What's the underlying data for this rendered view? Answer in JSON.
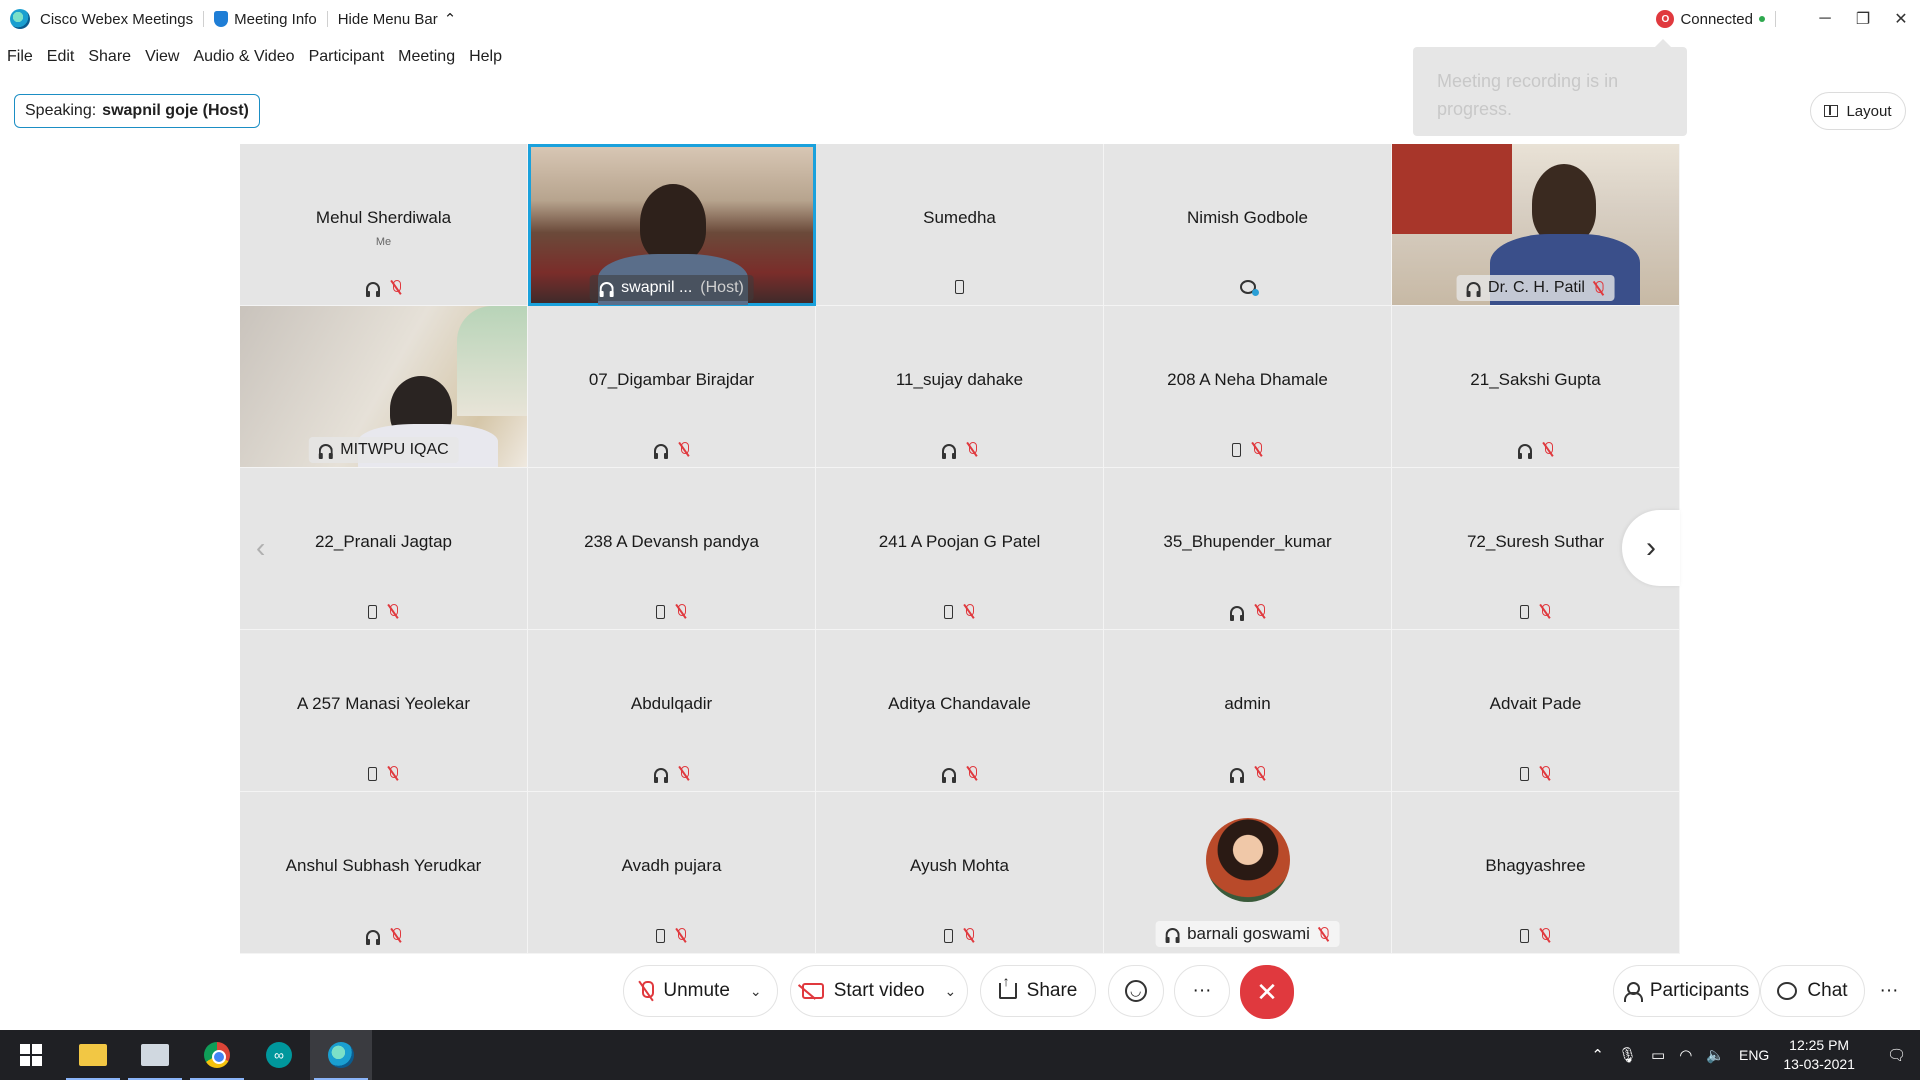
{
  "titlebar": {
    "app_name": "Cisco Webex Meetings",
    "meeting_info": "Meeting Info",
    "hide_menu": "Hide Menu Bar",
    "recording_badge": "O",
    "connection_status": "Connected"
  },
  "menu": [
    "File",
    "Edit",
    "Share",
    "View",
    "Audio & Video",
    "Participant",
    "Meeting",
    "Help"
  ],
  "speaking": {
    "prefix": "Speaking:",
    "name": "swapnil goje (Host)"
  },
  "recording_tooltip": "Meeting recording is in progress.",
  "layout_label": "Layout",
  "tiles": [
    {
      "name": "Mehul Sherdiwala",
      "sub": "Me",
      "audio": "headset",
      "muted": true
    },
    {
      "name": "swapnil ...",
      "host": "(Host)",
      "audio": "headset",
      "video": "swapnil"
    },
    {
      "name": "Sumedha",
      "audio": "phone",
      "muted": false
    },
    {
      "name": "Nimish Godbole",
      "audio": "sharing",
      "muted": false
    },
    {
      "name": "Dr. C. H. Patil",
      "audio": "headset",
      "muted": true,
      "video": "patil"
    },
    {
      "name": "MITWPU IQAC",
      "audio": "headset",
      "video": "mitwpu"
    },
    {
      "name": "07_Digambar Birajdar",
      "audio": "headset",
      "muted": true
    },
    {
      "name": "11_sujay dahake",
      "audio": "headset",
      "muted": true
    },
    {
      "name": "208 A Neha Dhamale",
      "audio": "phone",
      "muted": true
    },
    {
      "name": "21_Sakshi Gupta",
      "audio": "headset",
      "muted": true
    },
    {
      "name": "22_Pranali Jagtap",
      "audio": "phone",
      "muted": true
    },
    {
      "name": "238 A Devansh pandya",
      "audio": "phone",
      "muted": true
    },
    {
      "name": "241 A Poojan G Patel",
      "audio": "phone",
      "muted": true
    },
    {
      "name": "35_Bhupender_kumar",
      "audio": "headset",
      "muted": true
    },
    {
      "name": "72_Suresh Suthar",
      "audio": "phone",
      "muted": true
    },
    {
      "name": "A 257 Manasi Yeolekar",
      "audio": "phone",
      "muted": true
    },
    {
      "name": "Abdulqadir",
      "audio": "headset",
      "muted": true
    },
    {
      "name": "Aditya Chandavale",
      "audio": "headset",
      "muted": true
    },
    {
      "name": "admin",
      "audio": "headset",
      "muted": true
    },
    {
      "name": "Advait Pade",
      "audio": "phone",
      "muted": true
    },
    {
      "name": "Anshul Subhash Yerudkar",
      "audio": "headset",
      "muted": true
    },
    {
      "name": "Avadh pujara",
      "audio": "phone",
      "muted": true
    },
    {
      "name": "Ayush Mohta",
      "audio": "phone",
      "muted": true
    },
    {
      "name": "barnali goswami",
      "audio": "headset",
      "muted": true,
      "avatar": true
    },
    {
      "name": "Bhagyashree",
      "audio": "phone",
      "muted": true
    }
  ],
  "controls": {
    "unmute": "Unmute",
    "start_video": "Start video",
    "share": "Share",
    "more": "···",
    "end": "✕",
    "participants": "Participants",
    "chat": "Chat"
  },
  "taskbar": {
    "tray_language": "ENG",
    "time": "12:25 PM",
    "date": "13-03-2021"
  }
}
